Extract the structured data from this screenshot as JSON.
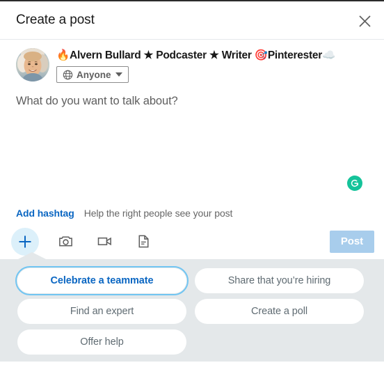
{
  "modal": {
    "title": "Create a post",
    "close_label": "Close",
    "close_icon": "close-icon"
  },
  "author": {
    "name": "🔥Alvern Bullard ★ Podcaster ★ Writer 🎯Pinterester☁️",
    "avatar_icon": "user-avatar-photo",
    "audience": {
      "label": "Anyone",
      "icon": "globe-icon",
      "caret_icon": "chevron-down-icon"
    }
  },
  "editor": {
    "placeholder": "What do you want to talk about?",
    "value": "",
    "assistant_icon": "grammarly-icon",
    "assistant_color": "#15c39a"
  },
  "hashtag": {
    "link_label": "Add hashtag",
    "hint": "Help the right people see your post"
  },
  "toolbar": {
    "items": [
      {
        "name": "add-content-button",
        "icon": "plus-icon",
        "active": true
      },
      {
        "name": "add-photo-button",
        "icon": "camera-icon",
        "active": false
      },
      {
        "name": "add-video-button",
        "icon": "video-camera-icon",
        "active": false
      },
      {
        "name": "add-document-button",
        "icon": "document-icon",
        "active": false
      }
    ],
    "post_label": "Post",
    "post_disabled": true
  },
  "suggestions": {
    "pills": [
      {
        "label": "Celebrate a teammate",
        "selected": true
      },
      {
        "label": "Share that you’re hiring",
        "selected": false
      },
      {
        "label": "Find an expert",
        "selected": false
      },
      {
        "label": "Create a poll",
        "selected": false
      },
      {
        "label": "Offer help",
        "selected": false
      }
    ]
  },
  "colors": {
    "brand_blue": "#0a66c2",
    "panel_bg": "#e4e8ea",
    "focus_ring": "#71c5f2",
    "post_disabled_bg": "#a8cdec"
  }
}
